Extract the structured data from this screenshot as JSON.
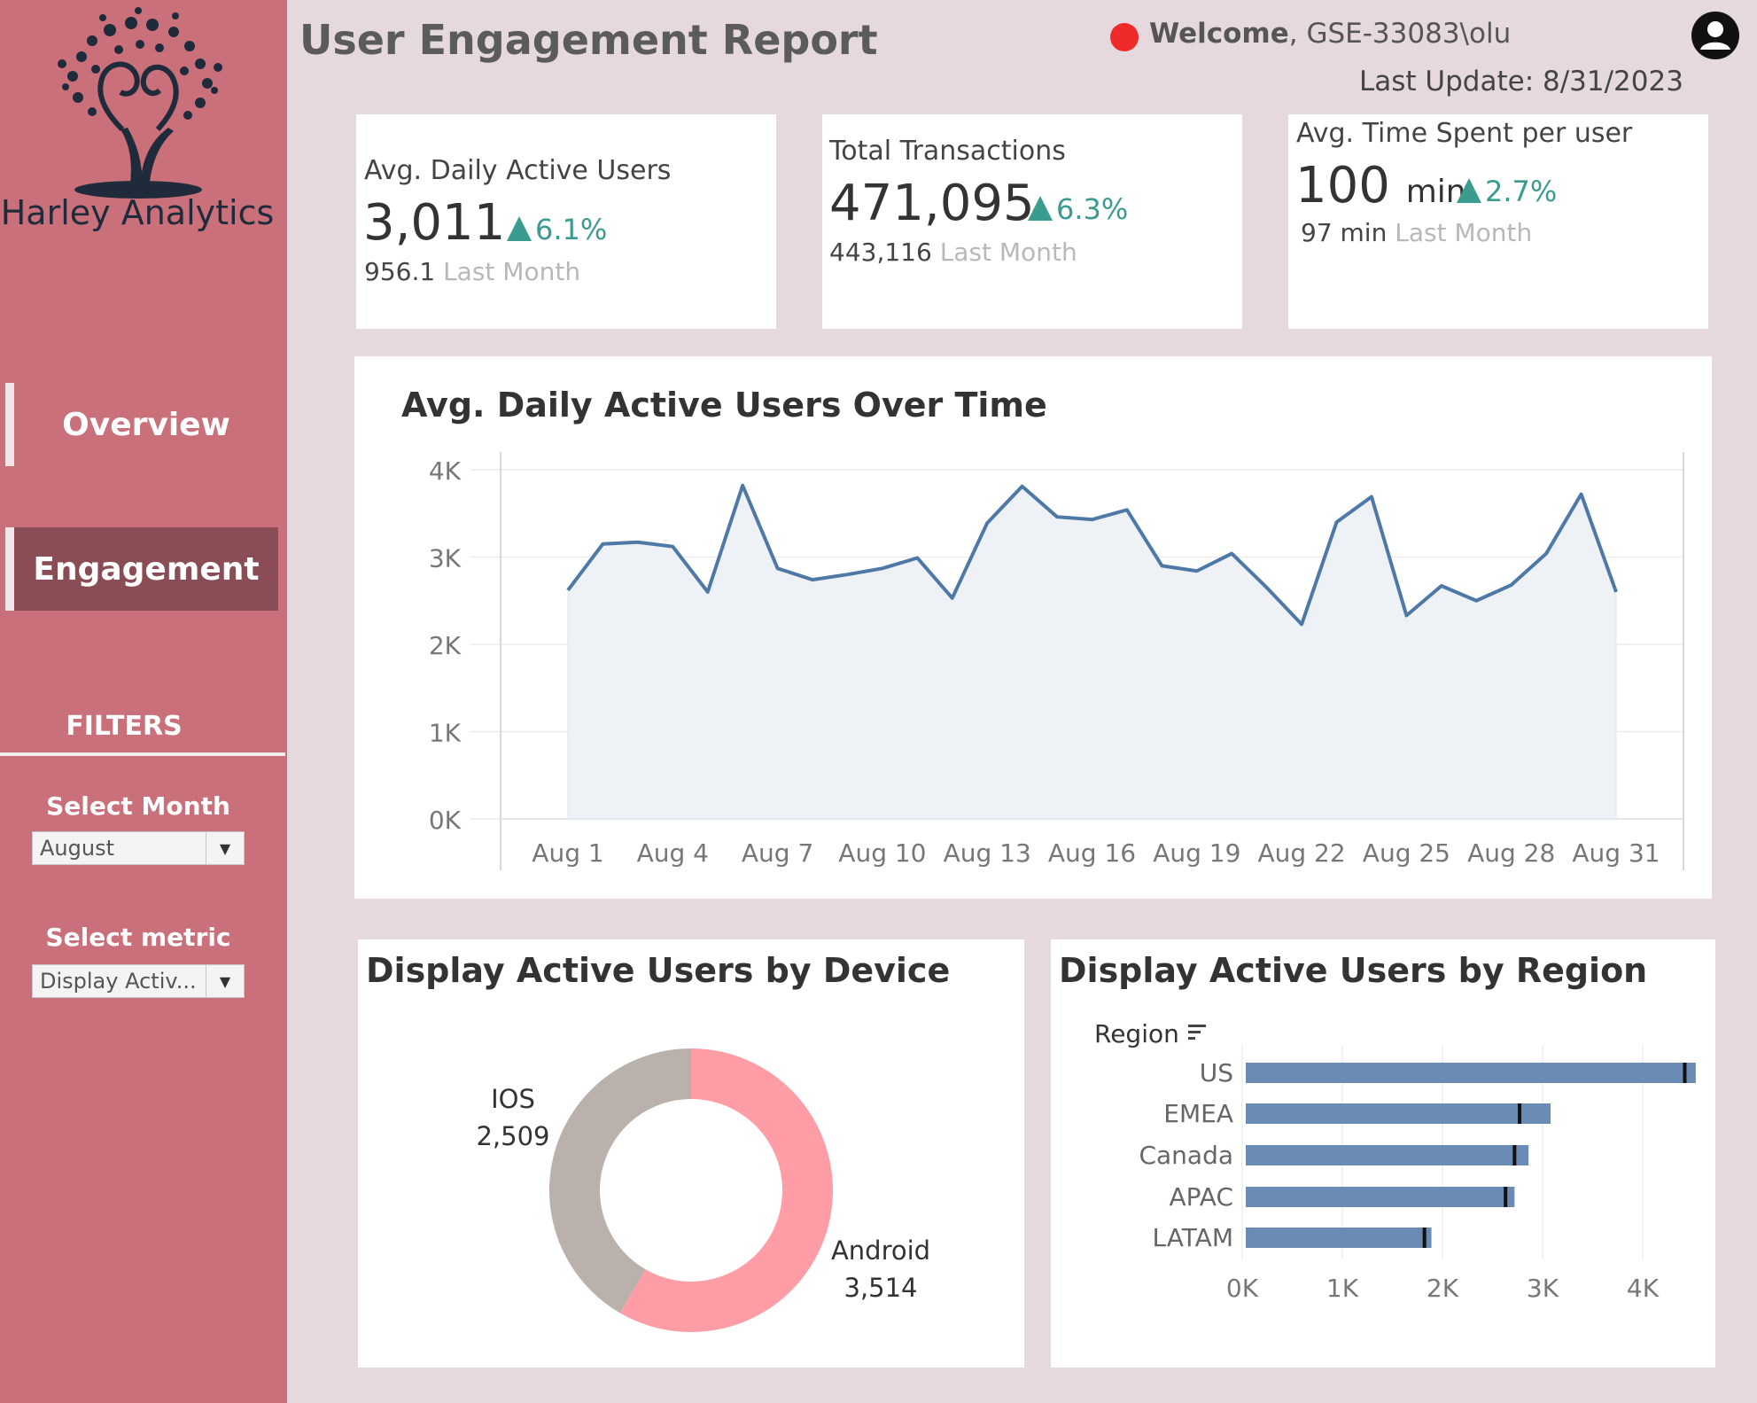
{
  "sidebar": {
    "logo_text": "Harley Analytics",
    "nav": [
      {
        "label": "Overview",
        "active": false
      },
      {
        "label": "Engagement",
        "active": true
      }
    ],
    "filters_title": "FILTERS",
    "filters": [
      {
        "label": "Select Month",
        "value": "August"
      },
      {
        "label": "Select metric",
        "value": "Display Activ..."
      }
    ]
  },
  "header": {
    "title": "User Engagement Report",
    "welcome_prefix": "Welcome",
    "welcome_user": ", GSE-33083\\olu",
    "last_update": "Last Update: 8/31/2023",
    "status_color": "#ee2a2a"
  },
  "kpis": [
    {
      "title": "Avg. Daily Active Users",
      "value": "3,011",
      "unit": "",
      "change": "6.1%",
      "prev_value": "956.1",
      "prev_label": "Last Month"
    },
    {
      "title": "Total Transactions",
      "value": "471,095",
      "unit": "",
      "change": "6.3%",
      "prev_value": "443,116",
      "prev_label": "Last Month"
    },
    {
      "title": "Avg. Time Spent per user",
      "value": "100",
      "unit": "min",
      "change": "2.7%",
      "prev_value": "97 min",
      "prev_label": "Last Month"
    }
  ],
  "colors": {
    "accent_up": "#3a9b8f",
    "line": "#4e79a7",
    "android": "#ff9da7",
    "ios": "#bab0ac",
    "bar": "#6a8cb4"
  },
  "line_chart": {
    "title": "Avg. Daily Active Users Over Time",
    "chart_data": {
      "type": "area",
      "title": "Avg. Daily Active Users Over Time",
      "x": [
        "Aug 1",
        "Aug 2",
        "Aug 3",
        "Aug 4",
        "Aug 5",
        "Aug 6",
        "Aug 7",
        "Aug 8",
        "Aug 9",
        "Aug 10",
        "Aug 11",
        "Aug 12",
        "Aug 13",
        "Aug 14",
        "Aug 15",
        "Aug 16",
        "Aug 17",
        "Aug 18",
        "Aug 19",
        "Aug 20",
        "Aug 21",
        "Aug 22",
        "Aug 23",
        "Aug 24",
        "Aug 25",
        "Aug 26",
        "Aug 27",
        "Aug 28",
        "Aug 29",
        "Aug 30",
        "Aug 31"
      ],
      "values": [
        2620,
        3150,
        3170,
        3120,
        2600,
        3820,
        2870,
        2740,
        2800,
        2870,
        2990,
        2530,
        3390,
        3810,
        3460,
        3430,
        3540,
        2900,
        2840,
        3040,
        2650,
        2230,
        3400,
        3690,
        2330,
        2670,
        2500,
        2680,
        3040,
        3720,
        2600
      ],
      "x_tick_labels": [
        "Aug 1",
        "Aug 4",
        "Aug 7",
        "Aug 10",
        "Aug 13",
        "Aug 16",
        "Aug 19",
        "Aug 22",
        "Aug 25",
        "Aug 28",
        "Aug 31"
      ],
      "y_tick_labels": [
        "0K",
        "1K",
        "2K",
        "3K",
        "4K"
      ],
      "y_ticks": [
        0,
        1000,
        2000,
        3000,
        4000
      ],
      "ylim": [
        0,
        4000
      ],
      "grid": true
    }
  },
  "device_chart": {
    "title": "Display Active Users by Device",
    "chart_data": {
      "type": "pie",
      "donut": true,
      "title": "Display Active Users by Device",
      "slices": [
        {
          "label": "Android",
          "value": 3514,
          "display": "3,514",
          "color": "#ff9da7"
        },
        {
          "label": "IOS",
          "value": 2509,
          "display": "2,509",
          "color": "#bab0ac"
        }
      ]
    }
  },
  "region_chart": {
    "title": "Display Active Users by Region",
    "axis_header": "Region",
    "chart_data": {
      "type": "bar",
      "orientation": "horizontal",
      "title": "Display Active Users by Region",
      "ylabel": "Region",
      "categories": [
        "US",
        "EMEA",
        "Canada",
        "APAC",
        "LATAM"
      ],
      "values": [
        4530,
        3080,
        2860,
        2720,
        1890
      ],
      "reference_marks": [
        4420,
        2770,
        2720,
        2630,
        1820
      ],
      "x_tick_labels": [
        "0K",
        "1K",
        "2K",
        "3K",
        "4K"
      ],
      "x_ticks": [
        0,
        1000,
        2000,
        3000,
        4000
      ],
      "xlim": [
        0,
        4600
      ]
    }
  }
}
